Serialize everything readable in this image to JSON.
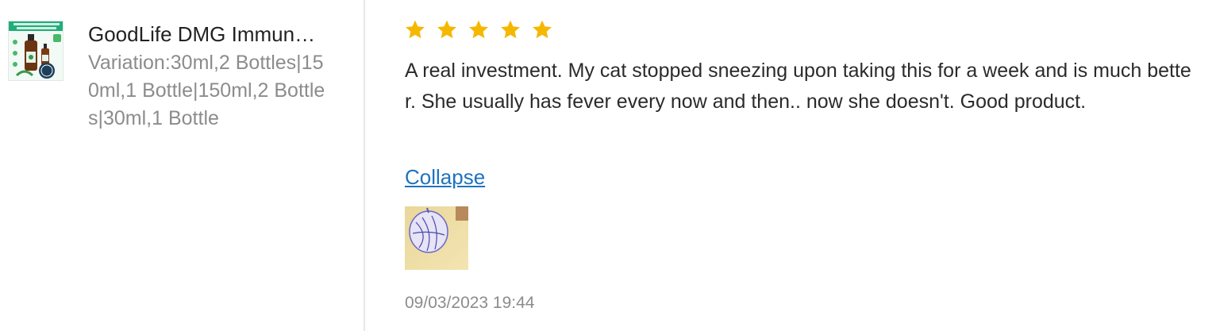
{
  "product": {
    "name": "GoodLife DMG Immune Booster",
    "variation": "Variation:30ml,2 Bottles|150ml,1 Bottle|150ml,2 Bottles|30ml,1 Bottle",
    "thumbnail_icon": "product-bottle-image"
  },
  "review": {
    "rating": 5,
    "rating_max": 5,
    "star_color": "#f5b800",
    "text": "A real investment. My cat stopped sneezing upon taking this for a week and is much better. She usually has fever every now and then.. now she doesn't. Good product.",
    "collapse_label": "Collapse",
    "photo_icon": "review-photo",
    "date": "09/03/2023 19:44"
  }
}
